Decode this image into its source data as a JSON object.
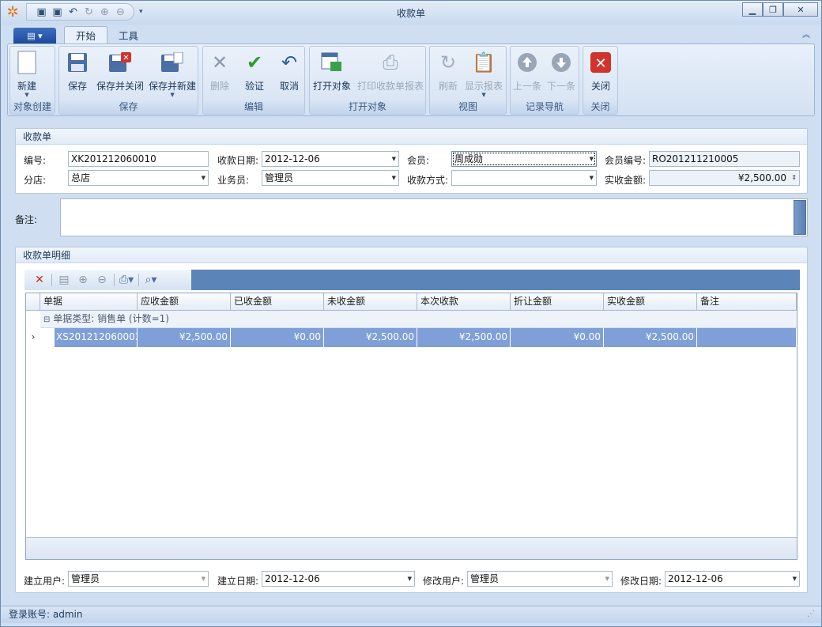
{
  "window": {
    "title": "收款单",
    "min": "▭",
    "max": "□",
    "close": "✕"
  },
  "tabs": [
    {
      "label": "开始"
    },
    {
      "label": "工具"
    }
  ],
  "ribbon": {
    "groups": [
      "对象创建",
      "保存",
      "编辑",
      "打开对象",
      "视图",
      "记录导航",
      "关闭"
    ],
    "buttons": [
      "新建",
      "保存",
      "保存并关闭",
      "保存并新建",
      "删除",
      "验证",
      "取消",
      "打开对象",
      "打印收款单报表",
      "刷新",
      "显示报表",
      "上一条",
      "下一条",
      "关闭"
    ]
  },
  "header_panel": {
    "title": "收款单",
    "number_label": "编号:",
    "number_value": "XK201212060010",
    "date_label": "收款日期:",
    "date_value": "2012-12-06",
    "member_label": "会员:",
    "member_value": "周成勋",
    "member_no_label": "会员编号:",
    "member_no_value": "RO201211210005",
    "store_label": "分店:",
    "store_value": "总店",
    "salesman_label": "业务员:",
    "salesman_value": "管理员",
    "method_label": "收款方式:",
    "method_value": "",
    "actual_label": "实收金额:",
    "actual_value": "¥2,500.00"
  },
  "remark": {
    "label": "备注:",
    "value": ""
  },
  "detail": {
    "title": "收款单明细",
    "columns": [
      "单据",
      "应收金额",
      "已收金额",
      "未收金额",
      "本次收款",
      "折让金额",
      "实收金额",
      "备注"
    ],
    "group_label": "单据类型: 销售单 (计数=1)",
    "row": {
      "cells": [
        "XS201212060002",
        "¥2,500.00",
        "¥0.00",
        "¥2,500.00",
        "¥2,500.00",
        "¥0.00",
        "¥2,500.00",
        ""
      ]
    }
  },
  "footer": {
    "create_user_label": "建立用户:",
    "create_user_value": "管理员",
    "create_date_label": "建立日期:",
    "create_date_value": "2012-12-06",
    "modify_user_label": "修改用户:",
    "modify_user_value": "管理员",
    "modify_date_label": "修改日期:",
    "modify_date_value": "2012-12-06"
  },
  "status": {
    "text": "登录账号: admin"
  },
  "colors": {
    "ribbon": "#d3e1f2",
    "grid_toolbar": "#5b84b8",
    "selected_row": "#7f9fd9",
    "close_red": "#c8281e",
    "check_green": "#2e9a2e"
  }
}
